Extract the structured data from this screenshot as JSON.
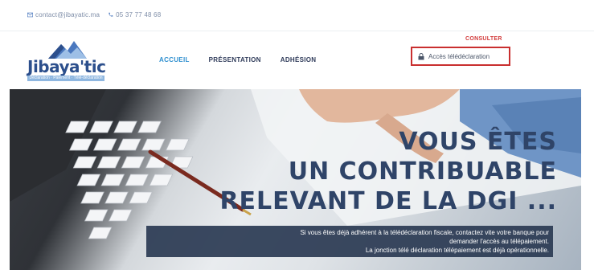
{
  "topbar": {
    "email": "contact@jibayatic.ma",
    "phone": "05 37 77 48 68"
  },
  "logo": {
    "name": "Jibaya'tic",
    "tagline": "Déclaration · Paiement · Télé-déclaration"
  },
  "nav": {
    "items": [
      {
        "label": "ACCUEIL",
        "active": true
      },
      {
        "label": "PRÉSENTATION",
        "active": false
      },
      {
        "label": "ADHÉSION",
        "active": false
      }
    ]
  },
  "login": {
    "label_above": "CONSULTER",
    "button_label": "Accès télédéclaration"
  },
  "hero": {
    "heading_line1": "VOUS ÊTES",
    "heading_line2": "UN CONTRIBUABLE",
    "heading_line3": "RELEVANT DE LA DGI ...",
    "caption_line1": "Si vous êtes déjà adhérent à la télédéclaration fiscale, contactez vite votre banque pour",
    "caption_line2": "demander l'accès au télépaiement.",
    "caption_line3": "La jonction télé déclaration télépaiement est déjà opérationnelle."
  },
  "colors": {
    "accent": "#2e8fcf",
    "brand": "#2c4f8c",
    "login_border": "#c92f2f",
    "hero_text": "#2f4468",
    "caption_bg": "#2a3a52"
  },
  "icons": {
    "email": "envelope-icon",
    "phone": "phone-icon",
    "lock": "lock-icon"
  }
}
